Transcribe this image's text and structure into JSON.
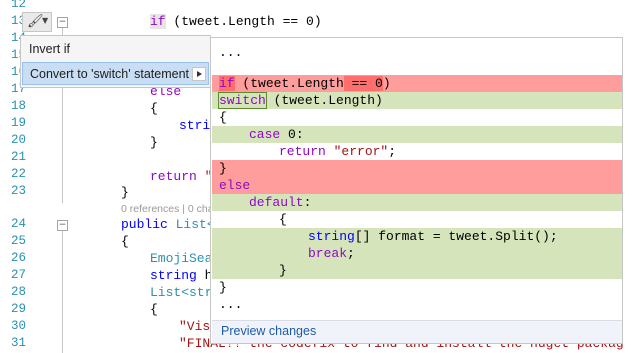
{
  "line_numbers": [
    "12",
    "13",
    "14",
    "15",
    "16",
    "17",
    "18",
    "19",
    "20",
    "21",
    "22",
    "23",
    "",
    "24",
    "25",
    "26",
    "27",
    "28",
    "29",
    "30",
    "31"
  ],
  "code_lines": {
    "l13": {
      "kw": "if",
      "rest": " (tweet.Length == 0)"
    },
    "l17": "else",
    "l18": "{",
    "l19": "stri",
    "l20": "}",
    "l22": {
      "kw": "return",
      "str": " \""
    },
    "l23": "}",
    "lens": "0 references | 0 cha",
    "l24": {
      "kw": "public",
      "type": " List<"
    },
    "l25": "{",
    "l26": "EmojiSea",
    "l27": {
      "kw": "string",
      "rest": " he"
    },
    "l28": {
      "type": "List<str"
    },
    "l29": "{",
    "l30": {
      "str": "\"Vis",
      "tail": "!\","
    },
    "l31": {
      "str": "\"FINAL!! the codefix to find and install the nuget package i ne"
    }
  },
  "lightbulb": {
    "icon": "brush-icon"
  },
  "menu": {
    "items": [
      {
        "label": "Invert if"
      },
      {
        "label": "Convert to 'switch' statement"
      }
    ]
  },
  "preview": {
    "ellipsis_top": "...",
    "lines": {
      "p1_if": "if",
      "p1_mid": " (tweet.Length",
      "p1_eq": " == 0",
      "p1_end": ")",
      "p2_switch": "switch",
      "p2_rest": " (tweet.Length)",
      "p3": "{",
      "p4_case": "case",
      "p4_rest": " 0:",
      "p5_return": "return",
      "p5_str": "\"error\"",
      "p5_end": ";",
      "p6": "}",
      "p7_else": "else",
      "p8_default": "default",
      "p8_end": ":",
      "p9": "{",
      "p10_type": "string",
      "p10_rest": "[] format = tweet.Split();",
      "p11_break": "break",
      "p11_end": ";",
      "p12": "}",
      "p13": "}",
      "ellipsis_bottom": "..."
    },
    "footer": "Preview changes"
  }
}
